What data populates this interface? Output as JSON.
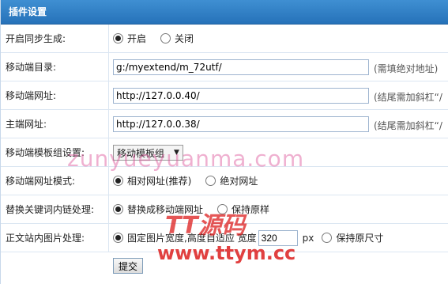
{
  "title": "插件设置",
  "rows": {
    "sync": {
      "label": "开启同步生成:",
      "options": [
        "开启",
        "关闭"
      ],
      "selected": "开启"
    },
    "mobile_dir": {
      "label": "移动端目录:",
      "value": "g:/myextend/m_72utf/",
      "hint": "(需填绝对地址)"
    },
    "mobile_url": {
      "label": "移动端网址:",
      "value": "http://127.0.0.40/",
      "hint": "(结尾需加斜杠“/"
    },
    "main_url": {
      "label": "主端网址:",
      "value": "http://127.0.0.38/",
      "hint": "(结尾需加斜杠“/"
    },
    "template": {
      "label": "移动端模板组设置:",
      "value": "移动模板组"
    },
    "url_mode": {
      "label": "移动端网址模式:",
      "options": [
        "相对网址(推荐)",
        "绝对网址"
      ],
      "selected": "相对网址(推荐)"
    },
    "keyword_link": {
      "label": "替换关键词内链处理:",
      "options": [
        "替换成移动端网址",
        "保持原样"
      ],
      "selected": "替换成移动端网址"
    },
    "image": {
      "label": "正文站内图片处理:",
      "options": [
        "固定图片宽度,高度自适应 宽度",
        "保持原尺寸"
      ],
      "selected": "固定图片宽度,高度自适应 宽度",
      "width": "320",
      "unit": "px"
    }
  },
  "submit_label": "提交",
  "watermarks": {
    "site": "zunyueyuanma.com",
    "brand": "TT源码",
    "url": "www.ttym.cc"
  }
}
